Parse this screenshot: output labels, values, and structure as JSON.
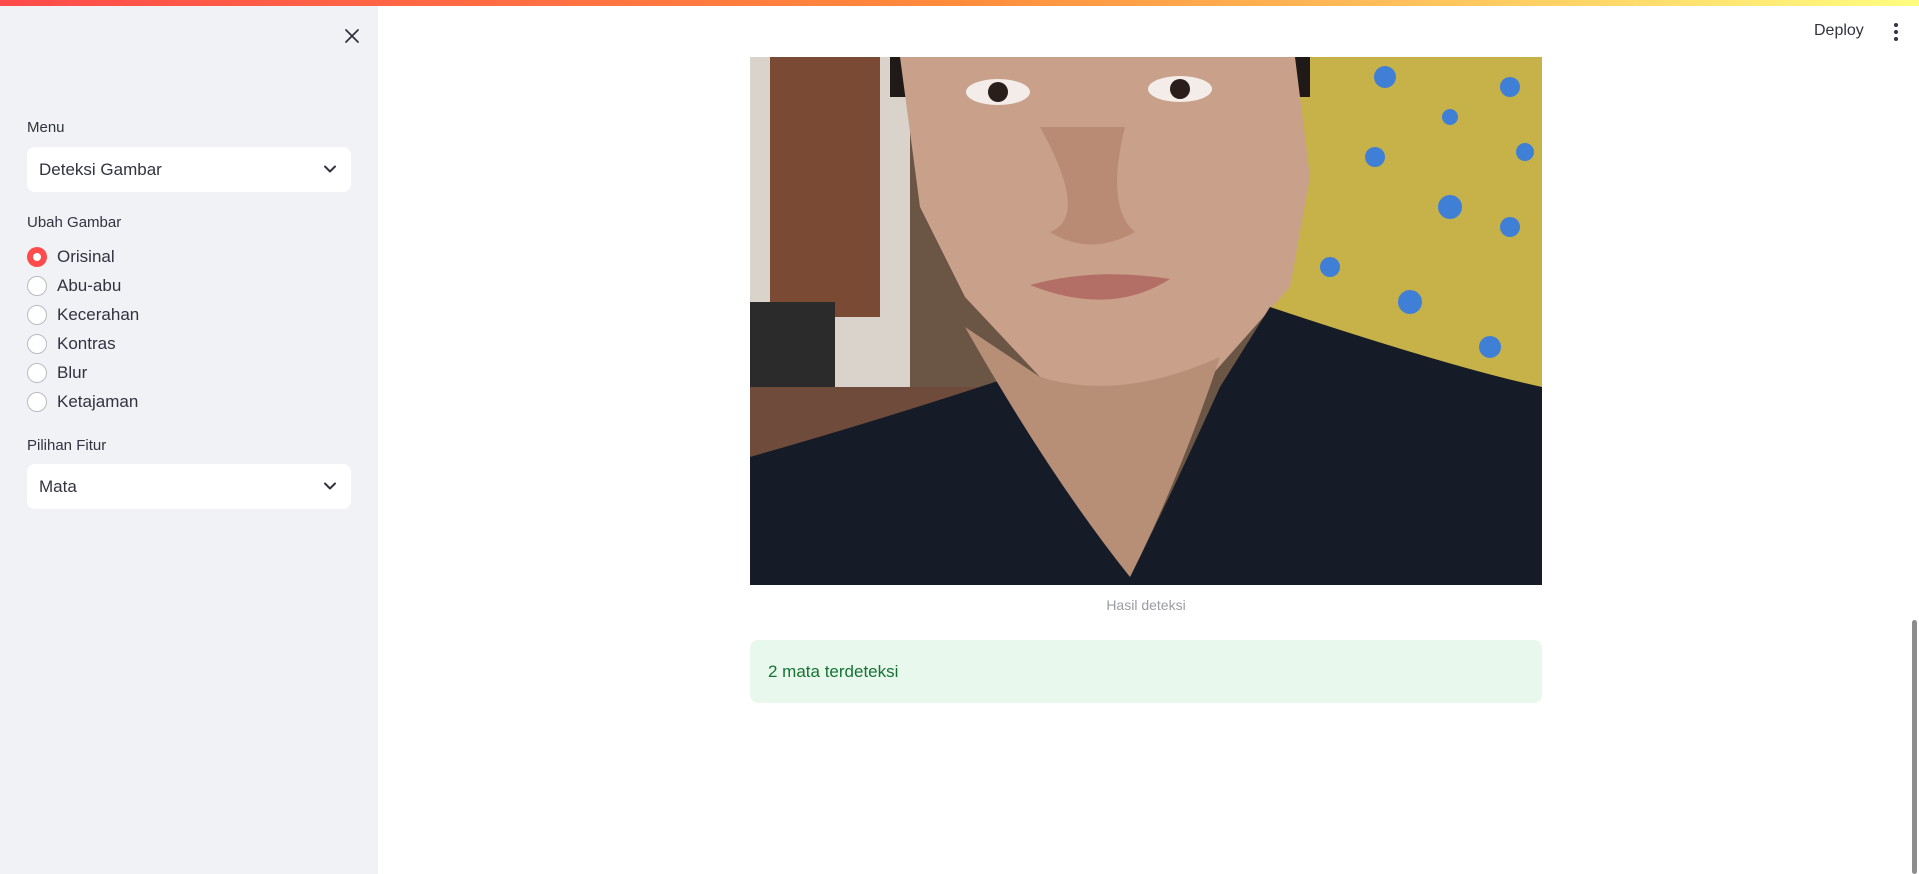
{
  "header": {
    "deploy_label": "Deploy"
  },
  "sidebar": {
    "menu_label": "Menu",
    "menu_value": "Deteksi Gambar",
    "ubah_label": "Ubah Gambar",
    "ubah_options": [
      "Orisinal",
      "Abu-abu",
      "Kecerahan",
      "Kontras",
      "Blur",
      "Ketajaman"
    ],
    "ubah_selected": "Orisinal",
    "fitur_label": "Pilihan Fitur",
    "fitur_value": "Mata"
  },
  "main": {
    "image_caption": "Hasil deteksi",
    "alert_text": "2 mata terdeteksi"
  },
  "colors": {
    "accent": "#ff4b4b",
    "success_bg": "#e8f8ec",
    "success_text": "#177233",
    "sidebar_bg": "#f0f2f6"
  }
}
